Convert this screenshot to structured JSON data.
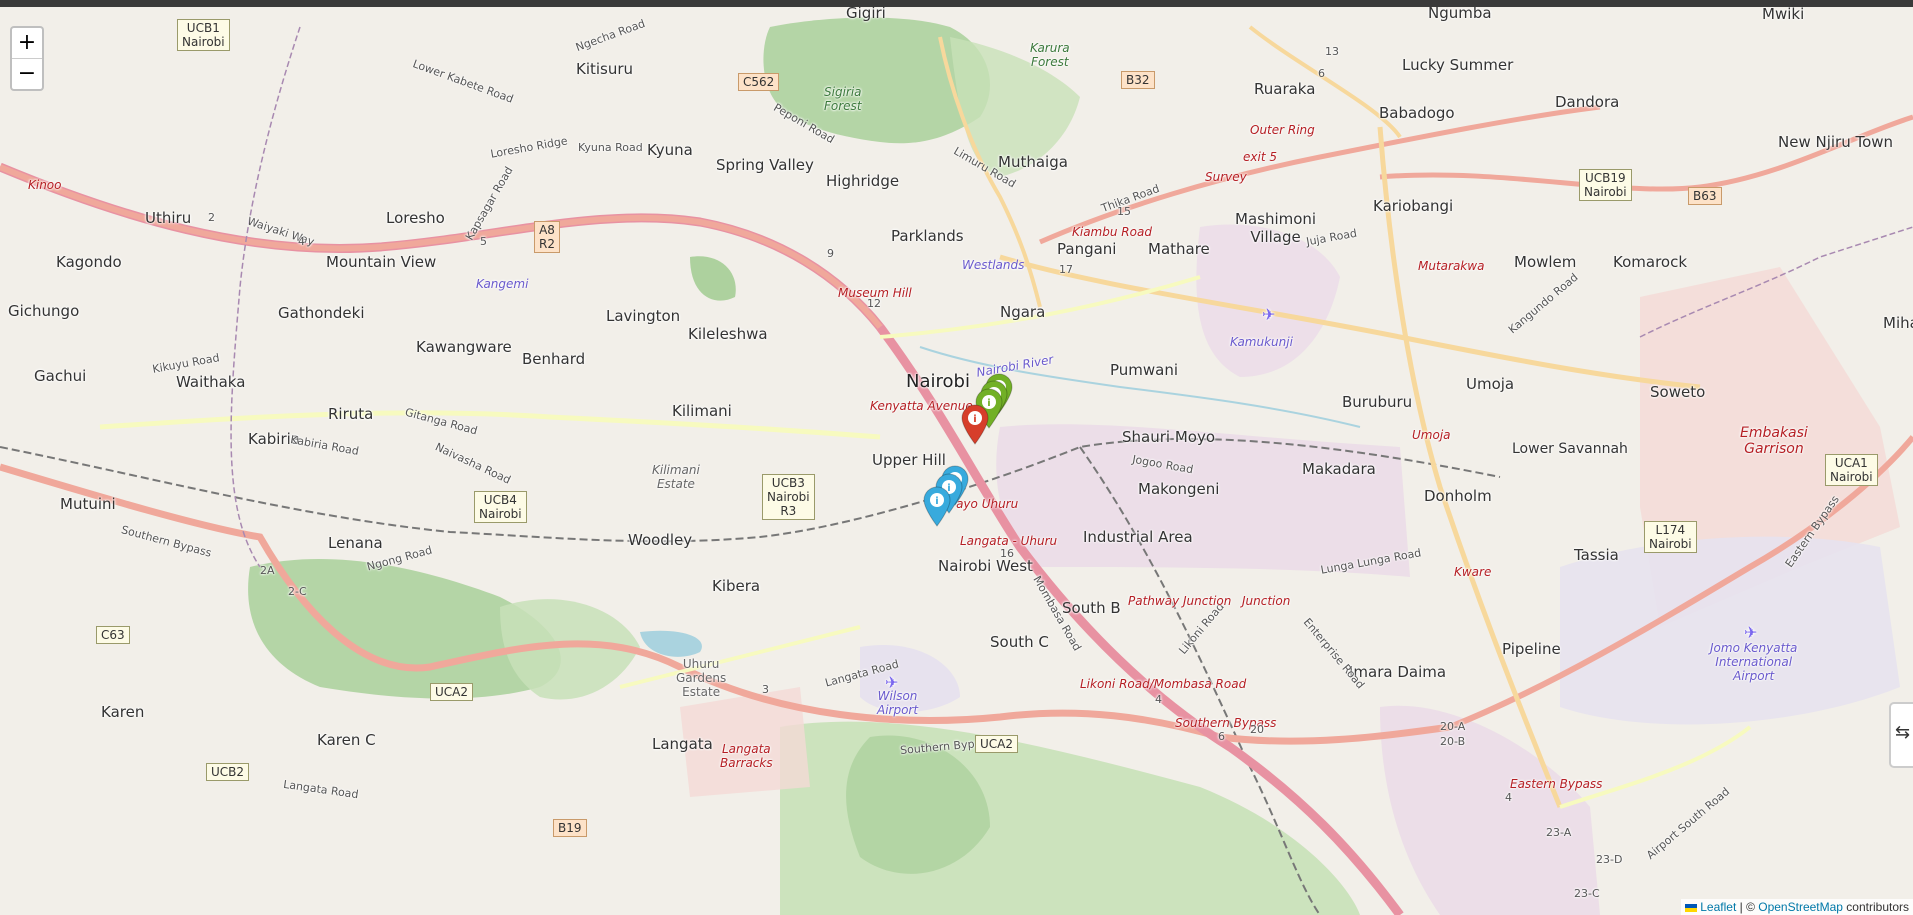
{
  "map": {
    "zoom_in_label": "+",
    "zoom_out_label": "−",
    "layers_label": "⇆",
    "attribution": {
      "leaflet": "Leaflet",
      "separator": " | © ",
      "osm": "OpenStreetMap",
      "contributors": " contributors"
    },
    "colors": {
      "green": "#72b026",
      "red": "#d63e2a",
      "blue": "#38aadd"
    },
    "markers": [
      {
        "color": "green",
        "icon": "info-icon"
      },
      {
        "color": "green",
        "icon": "info-icon"
      },
      {
        "color": "green",
        "icon": "info-icon"
      },
      {
        "color": "red",
        "icon": "info-icon"
      },
      {
        "color": "blue",
        "icon": "info-icon"
      },
      {
        "color": "blue",
        "icon": "info-icon"
      },
      {
        "color": "blue",
        "icon": "info-icon"
      }
    ],
    "marker_glyph": "i",
    "places": {
      "gigiri": "Gigiri",
      "ngumba": "Ngumba",
      "mwiki": "Mwiki",
      "kitisuru": "Kitisuru",
      "karura_forest": "Karura\nForest",
      "sigiria_forest": "Sigiria\nForest",
      "lucky_summer": "Lucky Summer",
      "ruaraka": "Ruaraka",
      "babadogo": "Babadogo",
      "dandora": "Dandora",
      "kyuna": "Kyuna",
      "spring_valley": "Spring Valley",
      "muthaiga": "Muthaiga",
      "new_njiru": "New Njiru Town",
      "highridge": "Highridge",
      "uthiru": "Uthiru",
      "loresho": "Loresho",
      "mashimoni": "Mashimoni\nVillage",
      "kariobangi": "Kariobangi",
      "parklands": "Parklands",
      "pangani": "Pangani",
      "mathare": "Mathare",
      "mountain_view": "Mountain View",
      "kagondo": "Kagondo",
      "westlands": "Westlands",
      "kangemi": "Kangemi",
      "mowlem": "Mowlem",
      "komarock": "Komarock",
      "gichungo": "Gichungo",
      "gathondeki": "Gathondeki",
      "lavington": "Lavington",
      "ngara": "Ngara",
      "kileleshwa": "Kileleshwa",
      "kamukunji": "Kamukunji",
      "mihango": "Miha",
      "kawangware": "Kawangware",
      "benhard": "Benhard",
      "pumwani": "Pumwani",
      "umoja": "Umoja",
      "soweto": "Soweto",
      "gachui": "Gachui",
      "waithaka": "Waithaka",
      "nairobi": "Nairobi",
      "buruburu": "Buruburu",
      "riruta": "Riruta",
      "kilimani": "Kilimani",
      "kabiria": "Kabiria",
      "shauri_moyo": "Shauri Moyo",
      "embakasi": "Embakasi\nGarrison",
      "lower_savannah": "Lower Savannah",
      "upper_hill": "Upper Hill",
      "makadara": "Makadara",
      "kilimani_estate": "Kilimani\nEstate",
      "makongeni": "Makongeni",
      "donholm": "Donholm",
      "mutuini": "Mutuini",
      "industrial_area": "Industrial Area",
      "lenana": "Lenana",
      "woodley": "Woodley",
      "tassia": "Tassia",
      "nairobi_west": "Nairobi West",
      "kibera": "Kibera",
      "south_b": "South B",
      "south_c": "South C",
      "pipeline": "Pipeline",
      "imara_daima": "Imara Daima",
      "uhuru_gardens": "Uhuru\nGardens\nEstate",
      "wilson_airport": "Wilson\nAirport",
      "jkia": "Jomo Kenyatta\nInternational\nAirport",
      "karen": "Karen",
      "langata": "Langata",
      "langata_barracks": "Langata\nBarracks",
      "karen_c": "Karen C"
    },
    "roads": {
      "ngecha": "Ngecha Road",
      "lower_kabete": "Lower Kabete Road",
      "peponi": "Peponi Road",
      "limuru": "Limuru Road",
      "loresho_ridge": "Loresho Ridge",
      "kyuna_road": "Kyuna Road",
      "waiyaki": "Waiyaki Way",
      "kapsagar": "Kapsagar Road",
      "thika": "Thika Road",
      "juja": "Juja Road",
      "kikuyu": "Kikuyu Road",
      "kabiria_road": "Kabiria Road",
      "naivasha": "Naivasha Road",
      "gitanga": "Gitanga Road",
      "ngong": "Ngong Road",
      "southern_bypass": "Southern Bypass",
      "langata_road": "Langata Road",
      "jogoo": "Jogoo Road",
      "lunga_lunga": "Lunga Lunga Road",
      "mombasa": "Mombasa Road",
      "kangundo": "Kangundo Road",
      "airport_south": "Airport South Road",
      "likoni": "Likoni Road",
      "enterprise": "Enterprise Road",
      "kinoo": "Kinoo",
      "kiambu": "Kiambu Road"
    },
    "red_labels": {
      "outer_ring": "Outer Ring",
      "exit5": "exit 5",
      "survey": "Survey",
      "museum_hill": "Museum Hill",
      "kenyatta_ave": "Kenyatta Avenue",
      "mutarakwa": "Mutarakwa",
      "umoja_r": "Umoja",
      "nyayo_uhuru": "Nyayo Uhuru",
      "langata_uhuru": "Langata - Uhuru",
      "pathway_junction": "Pathway Junction",
      "junction": "Junction",
      "kware": "Kware",
      "likoni_mombasa": "Likoni Road/Mombasa Road",
      "eastern_bypass": "Eastern Bypass",
      "southern_bypass_r": "Southern Bypass",
      "eastern_bypass_side": "Eastern Bypass"
    },
    "river": "Nairobi River",
    "shields": {
      "ucb1": "UCB1\nNairobi",
      "c562": "C562",
      "b32": "B32",
      "a8": "A8\nR2",
      "ucb19": "UCB19\nNairobi",
      "b63": "B63",
      "ucb4": "UCB4\nNairobi",
      "ucb3": "UCB3\nNairobi\nR3",
      "uca1": "UCA1\nNairobi",
      "l174": "L174\nNairobi",
      "c63": "C63",
      "uca2": "UCA2",
      "uca2b": "UCA2",
      "ucb2": "UCB2",
      "b19": "B19"
    },
    "road_numbers": {
      "n1": "1",
      "n2": "2",
      "n4": "4",
      "n5": "5",
      "n9": "9",
      "n12": "12",
      "n13": "13",
      "n15": "15",
      "n17": "17",
      "n6": "6",
      "n16": "16",
      "n2a": "2A",
      "n2c": "2-C",
      "n3": "3",
      "n20a": "20-A",
      "n20b": "20-B",
      "n23a": "23-A",
      "n23d": "23-D",
      "n23c": "23-C",
      "n20": "20"
    }
  }
}
